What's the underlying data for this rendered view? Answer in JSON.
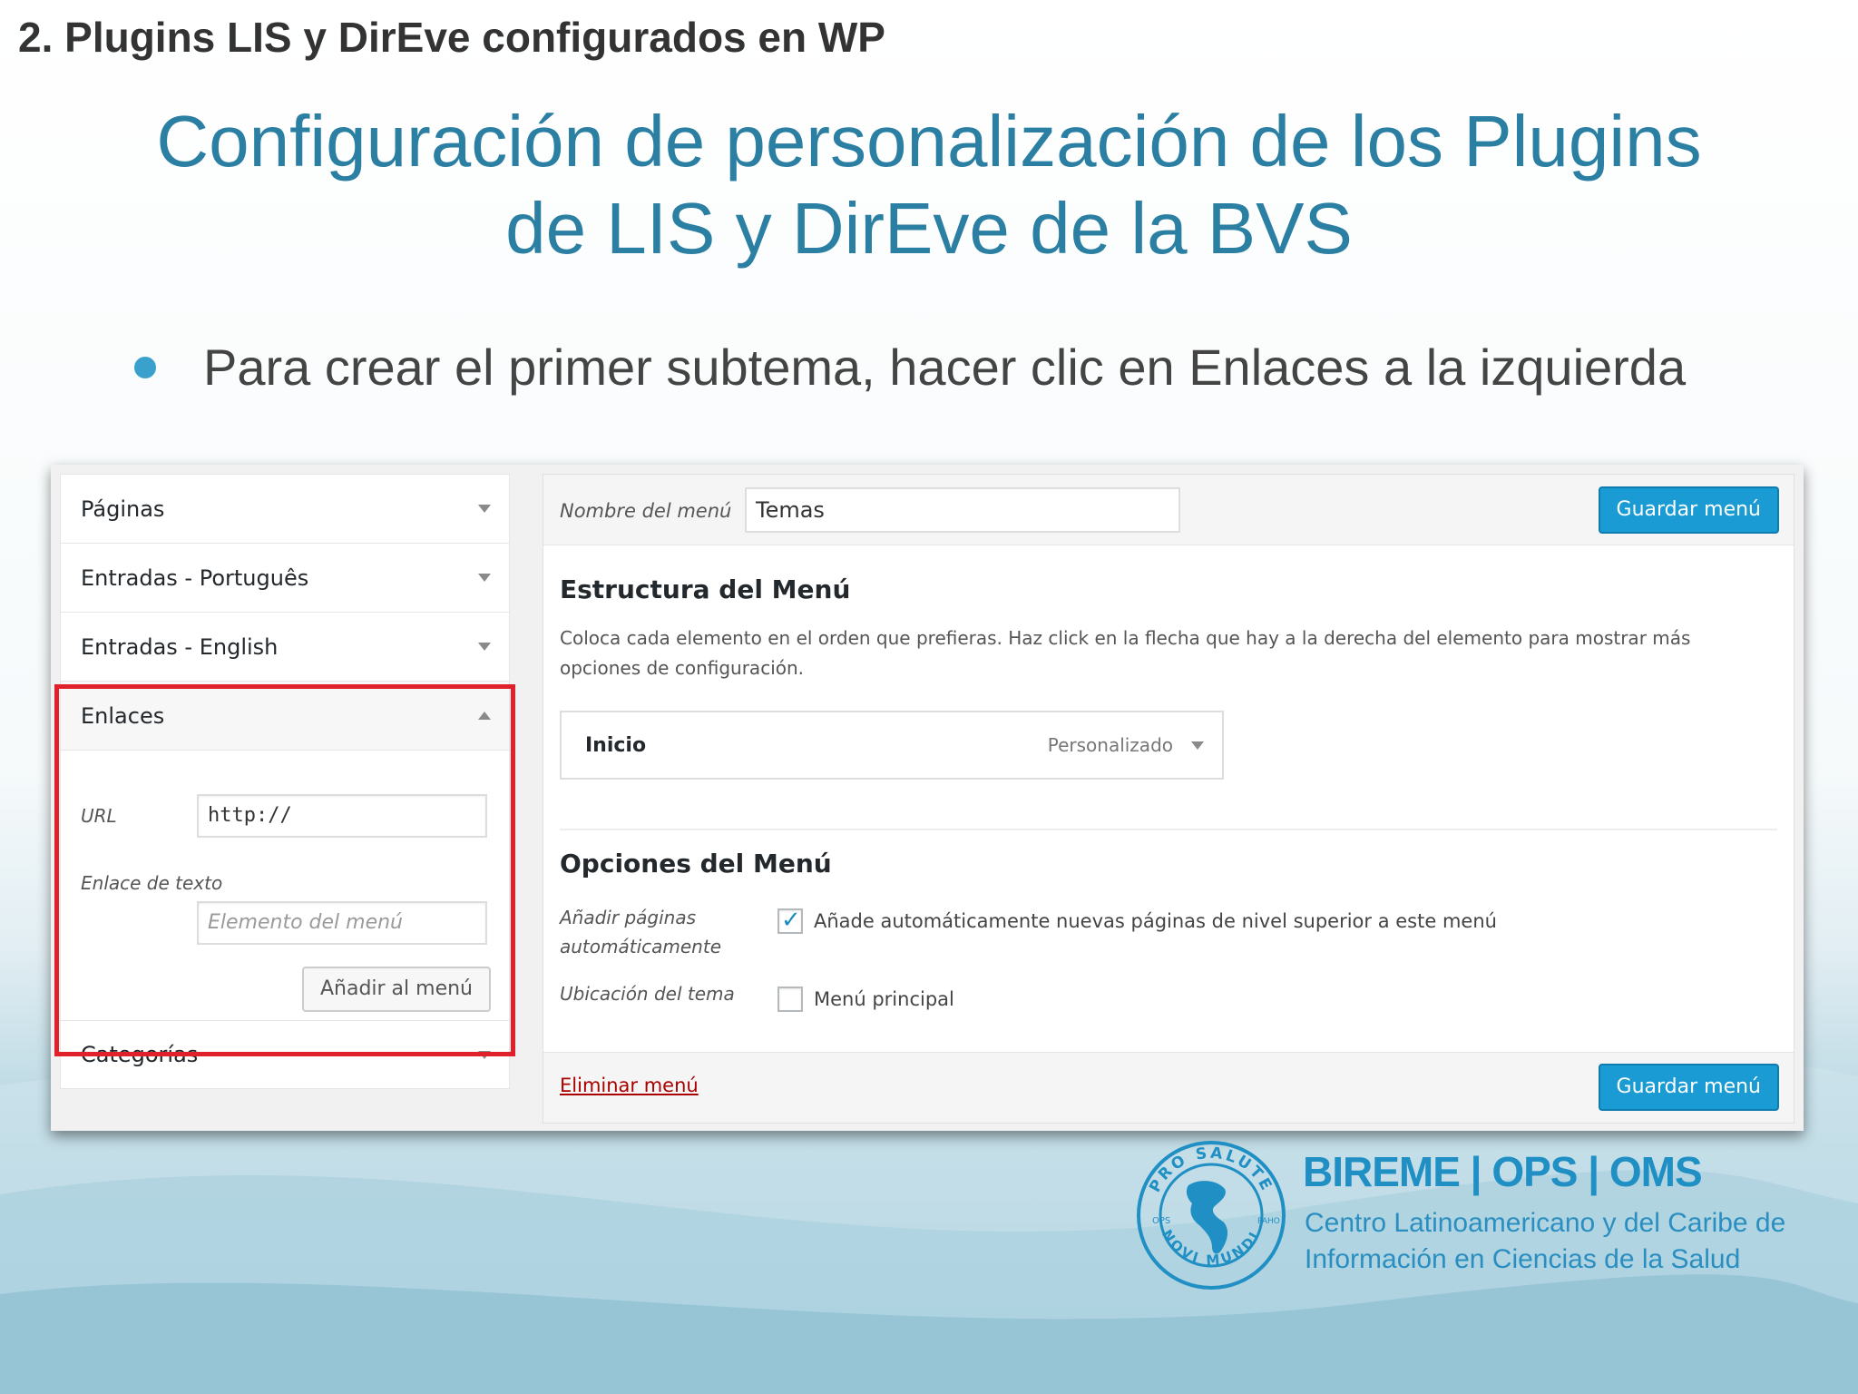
{
  "slide": {
    "section": "2. Plugins LIS y DirEve configurados en WP",
    "title_line1": "Configuración de personalización de los Plugins",
    "title_line2": "de LIS y DirEve de la BVS",
    "bullet": "Para crear el primer subtema, hacer clic en Enlaces a la izquierda",
    "colors": {
      "title": "#2a7fa2",
      "bullet": "#3aa0cc",
      "highlight": "#e0202b"
    }
  },
  "accordion": {
    "items": [
      {
        "label": "Páginas"
      },
      {
        "label": "Entradas - Português"
      },
      {
        "label": "Entradas - English"
      }
    ],
    "open": {
      "label": "Enlaces",
      "url_label": "URL",
      "url_value": "http://",
      "text_label": "Enlace de texto",
      "text_placeholder": "Elemento del menú",
      "add_button": "Añadir al menú"
    },
    "last": {
      "label": "Categorías"
    }
  },
  "editor": {
    "menu_name_label": "Nombre del menú",
    "menu_name_value": "Temas",
    "save_button": "Guardar menú",
    "structure_title": "Estructura del Menú",
    "structure_desc": "Coloca cada elemento en el orden que prefieras. Haz click en la flecha que hay a la derecha del elemento para mostrar más opciones de configuración.",
    "menu_item": {
      "title": "Inicio",
      "type": "Personalizado"
    },
    "options_title": "Opciones del Menú",
    "auto_add_label_1": "Añadir páginas",
    "auto_add_label_2": "automáticamente",
    "auto_add_text": "Añade automáticamente nuevas páginas de nivel superior a este menú",
    "auto_add_checked": true,
    "location_label": "Ubicación del tema",
    "location_text": "Menú principal",
    "location_checked": false,
    "delete_link": "Eliminar menú",
    "save_button_bottom": "Guardar menú"
  },
  "logo": {
    "seal_top": "PRO SALUTE",
    "seal_bottom": "NOVI MUNDI",
    "seal_left": "OPS",
    "seal_right": "PAHO",
    "title": "BIREME | OPS | OMS",
    "sub_line1": "Centro Latinoamericano y del Caribe de",
    "sub_line2": "Información en Ciencias de la Salud"
  }
}
